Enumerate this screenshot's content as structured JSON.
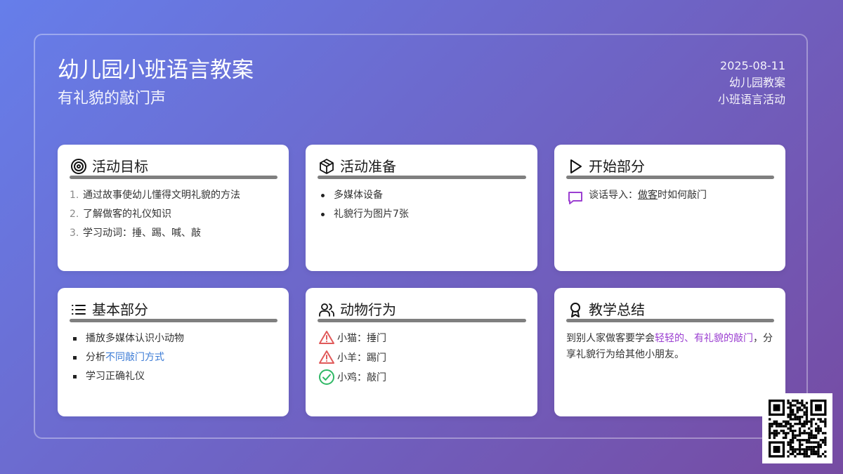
{
  "header": {
    "title": "幼儿园小班语言教案",
    "subtitle": "有礼貌的敲门声",
    "date": "2025-08-11",
    "category": "幼儿园教案",
    "activity_type": "小班语言活动"
  },
  "cards": {
    "goals": {
      "title": "活动目标",
      "icon": "target-icon",
      "items": [
        {
          "num": "1.",
          "text": "通过故事使幼儿懂得文明礼貌的方法"
        },
        {
          "num": "2.",
          "text": "了解做客的礼仪知识"
        },
        {
          "num": "3.",
          "text": "学习动词：捶、踢、喊、敲"
        }
      ]
    },
    "prep": {
      "title": "活动准备",
      "icon": "box-icon",
      "items": [
        "多媒体设备",
        "礼貌行为图片7张"
      ]
    },
    "start": {
      "title": "开始部分",
      "icon": "play-icon",
      "intro_prefix": "谈话导入：",
      "intro_link": "做客",
      "intro_suffix": "时如何敲门"
    },
    "basic": {
      "title": "基本部分",
      "icon": "list-icon",
      "items": [
        {
          "prefix": "播放多媒体认识小动物",
          "link": ""
        },
        {
          "prefix": "分析",
          "link": "不同敲门方式"
        },
        {
          "prefix": "学习正确礼仪",
          "link": ""
        }
      ]
    },
    "animals": {
      "title": "动物行为",
      "icon": "users-icon",
      "rows": [
        {
          "icon": "warning-icon",
          "text": "小猫：捶门"
        },
        {
          "icon": "warning-icon",
          "text": "小羊：踢门"
        },
        {
          "icon": "check-circle-icon",
          "text": "小鸡：敲门"
        }
      ]
    },
    "summary": {
      "title": "教学总结",
      "icon": "award-icon",
      "text_prefix": "到别人家做客要学会",
      "highlight": "轻轻的、有礼貌的敲门",
      "text_suffix": "，分享礼貌行为给其他小朋友。"
    }
  },
  "colors": {
    "bg_start": "#667eea",
    "bg_end": "#764ba2",
    "link_blue": "#3b7bd6",
    "highlight_purple": "#9b3fd1",
    "warning_red": "#e05a5a",
    "check_green": "#2fb865"
  }
}
